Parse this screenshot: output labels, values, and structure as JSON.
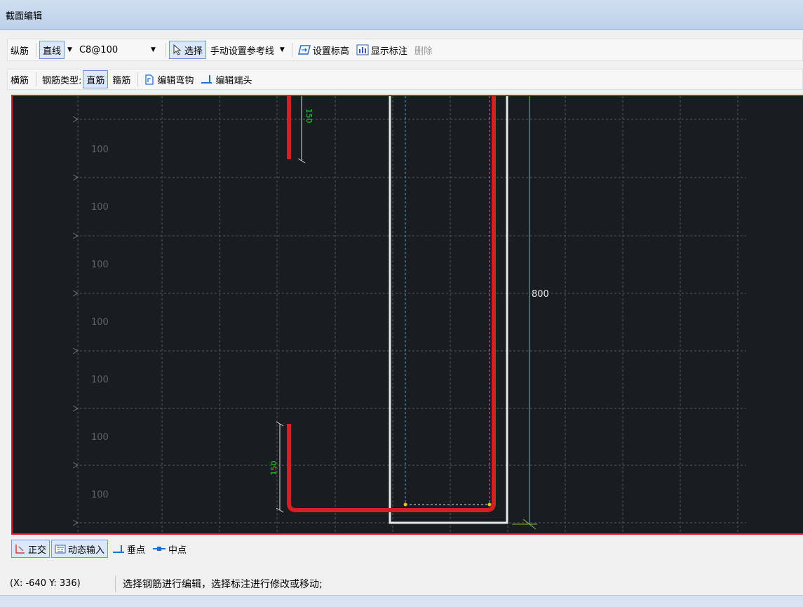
{
  "window": {
    "title": "截面编辑"
  },
  "toolbar1": {
    "group_label": "纵筋",
    "line_mode": "直线",
    "rebar_spec": "C8@100",
    "select_label": "选择",
    "ref_line_label": "手动设置参考线",
    "set_elevation_label": "设置标高",
    "show_annotation_label": "显示标注",
    "delete_label": "删除"
  },
  "toolbar2": {
    "group_label": "横筋",
    "rebar_type_label": "钢筋类型:",
    "straight_label": "直筋",
    "stirrup_label": "箍筋",
    "edit_hook_label": "编辑弯钩",
    "edit_end_label": "编辑端头"
  },
  "canvas": {
    "row_labels": [
      "100",
      "100",
      "100",
      "100",
      "100",
      "100",
      "100"
    ],
    "dim_top": "150",
    "dim_bottom": "150",
    "dim_height": "800",
    "colors": {
      "background": "#191c21",
      "rebar": "#d42020",
      "section": "#e8e8e8",
      "dim_green": "#7fc040",
      "dim_text_green": "#22dd22",
      "grid": "#555a60",
      "frame": "#e02020"
    }
  },
  "snapbar": {
    "ortho_label": "正交",
    "dynamic_input_label": "动态输入",
    "perpendicular_label": "垂点",
    "midpoint_label": "中点"
  },
  "status": {
    "coords": "(X: -640 Y: 336)",
    "message": "选择钢筋进行编辑，选择标注进行修改或移动;"
  }
}
